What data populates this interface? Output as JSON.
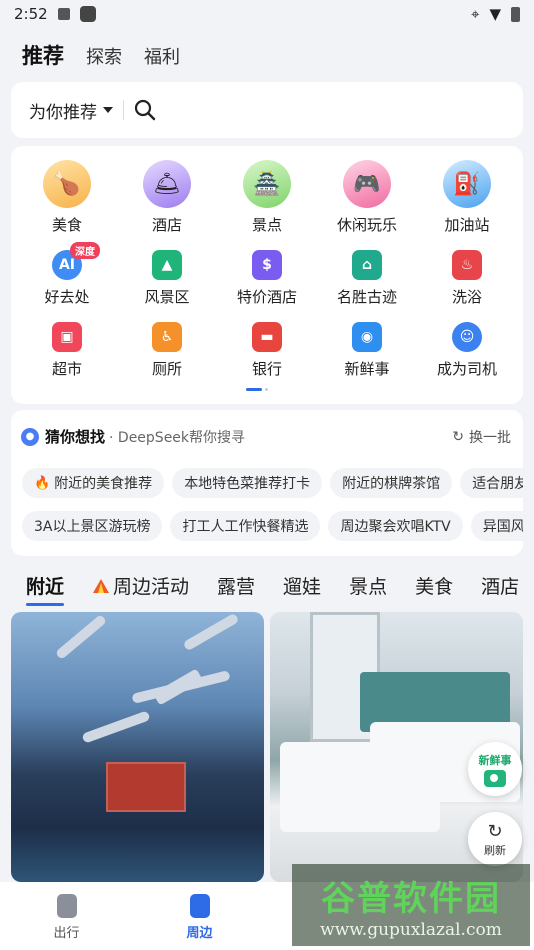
{
  "status_bar": {
    "time": "2:52"
  },
  "top_tabs": [
    {
      "label": "推荐",
      "active": true
    },
    {
      "label": "探索",
      "active": false
    },
    {
      "label": "福利",
      "active": false
    }
  ],
  "search": {
    "selector_label": "为你推荐"
  },
  "quick_grid": [
    {
      "label": "美食",
      "icon": "food-icon"
    },
    {
      "label": "酒店",
      "icon": "hotel-icon"
    },
    {
      "label": "景点",
      "icon": "attraction-icon"
    },
    {
      "label": "休闲玩乐",
      "icon": "game-icon"
    },
    {
      "label": "加油站",
      "icon": "gas-station-icon"
    },
    {
      "label": "好去处",
      "icon": "ai-icon",
      "badge": "深度"
    },
    {
      "label": "风景区",
      "icon": "scenic-icon"
    },
    {
      "label": "特价酒店",
      "icon": "discount-hotel-icon"
    },
    {
      "label": "名胜古迹",
      "icon": "landmark-icon"
    },
    {
      "label": "洗浴",
      "icon": "bath-icon"
    },
    {
      "label": "超市",
      "icon": "cart-icon"
    },
    {
      "label": "厕所",
      "icon": "toilet-icon"
    },
    {
      "label": "银行",
      "icon": "bank-icon"
    },
    {
      "label": "新鲜事",
      "icon": "camera-icon"
    },
    {
      "label": "成为司机",
      "icon": "driver-icon"
    }
  ],
  "guess": {
    "title": "猜你想找",
    "subtitle": "· DeepSeek帮你搜寻",
    "refresh_label": "换一批",
    "row1": [
      "附近的美食推荐",
      "本地特色菜推荐打卡",
      "附近的棋牌茶馆",
      "适合朋友"
    ],
    "row2": [
      "3A以上景区游玩榜",
      "打工人工作快餐精选",
      "周边聚会欢唱KTV",
      "异国风"
    ]
  },
  "category_tabs": [
    "附近",
    "周边活动",
    "露营",
    "遛娃",
    "景点",
    "美食",
    "酒店"
  ],
  "fab": {
    "news_label": "新鲜事",
    "refresh_label": "刷新"
  },
  "bottom_nav": [
    {
      "label": "出行",
      "active": false
    },
    {
      "label": "周边",
      "active": true
    }
  ],
  "watermark": {
    "line1": "谷普软件园",
    "line2": "www.gupuxlazal.com"
  },
  "colors": {
    "accent": "#2e6be6",
    "fire": "#f05a28",
    "badge": "#f0405a"
  }
}
